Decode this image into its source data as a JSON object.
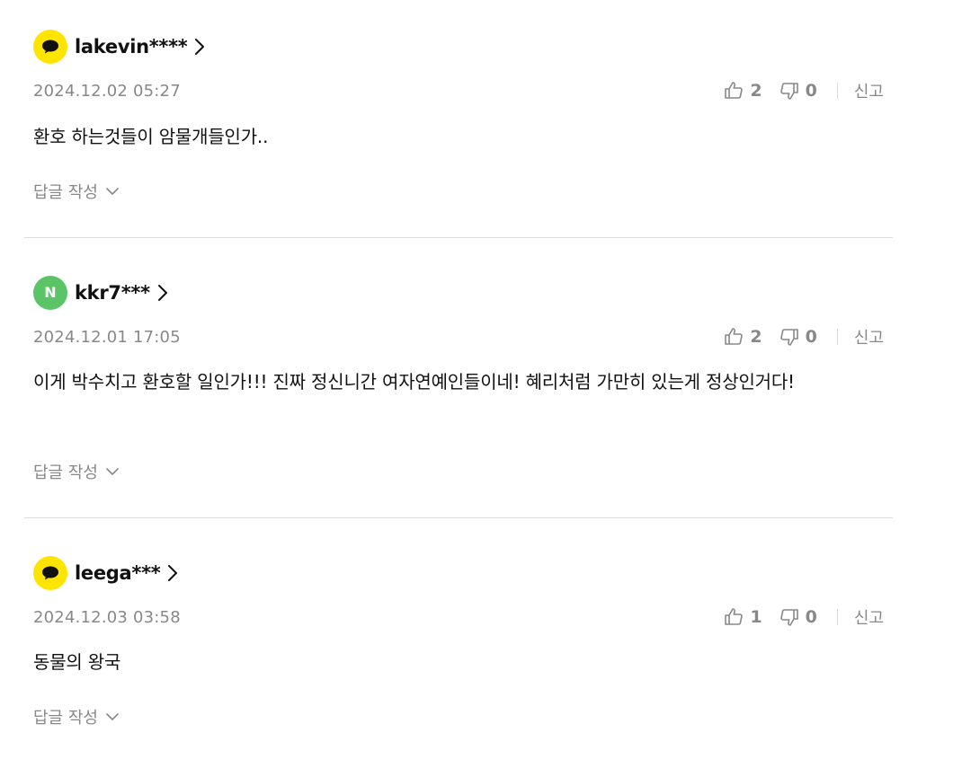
{
  "comments": [
    {
      "avatar": "kakao-speech-bubble-icon",
      "username": "lakevin****",
      "date": "2024.12.02 05:27",
      "likes": "2",
      "dislikes": "0",
      "report_label": "신고",
      "content": "환호 하는것들이 암물개들인가..",
      "reply_label": "답글 작성"
    },
    {
      "avatar": "naver-n-icon",
      "avatar_letter": "N",
      "username": "kkr7***",
      "date": "2024.12.01 17:05",
      "likes": "2",
      "dislikes": "0",
      "report_label": "신고",
      "content": "이게 박수치고 환호할 일인가!!! 진짜 정신니간 여자연예인들이네! 혜리처럼 가만히 있는게 정상인거다!",
      "reply_label": "답글 작성"
    },
    {
      "avatar": "kakao-speech-bubble-icon",
      "username": "leega***",
      "date": "2024.12.03 03:58",
      "likes": "1",
      "dislikes": "0",
      "report_label": "신고",
      "content": "동물의 왕국",
      "reply_label": "답글 작성"
    }
  ],
  "colors": {
    "kakao_yellow": "#fee500",
    "naver_green": "#5ac466",
    "meta_gray": "#888888",
    "divider": "#dcdcdc"
  }
}
